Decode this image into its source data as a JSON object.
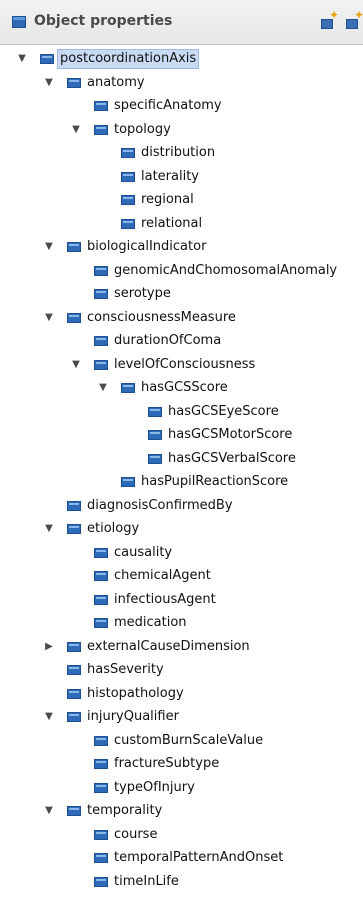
{
  "panel": {
    "title": "Object properties",
    "icon": "object-property-icon",
    "buttons": [
      {
        "name": "add-sub-property-button",
        "icon": "add-sub-property-icon"
      },
      {
        "name": "add-sibling-property-button",
        "icon": "add-sibling-property-icon"
      }
    ]
  },
  "colors": {
    "icon_blue": "#2d6bb8",
    "selection": "#c8dbf3"
  },
  "tree": [
    {
      "label": "postcoordinationAxis",
      "depth": 0,
      "toggle": "expanded",
      "selected": true
    },
    {
      "label": "anatomy",
      "depth": 1,
      "toggle": "expanded"
    },
    {
      "label": "specificAnatomy",
      "depth": 2,
      "toggle": "none"
    },
    {
      "label": "topology",
      "depth": 2,
      "toggle": "expanded"
    },
    {
      "label": "distribution",
      "depth": 3,
      "toggle": "none"
    },
    {
      "label": "laterality",
      "depth": 3,
      "toggle": "none"
    },
    {
      "label": "regional",
      "depth": 3,
      "toggle": "none"
    },
    {
      "label": "relational",
      "depth": 3,
      "toggle": "none"
    },
    {
      "label": "biologicalIndicator",
      "depth": 1,
      "toggle": "expanded"
    },
    {
      "label": "genomicAndChomosomalAnomaly",
      "depth": 2,
      "toggle": "none"
    },
    {
      "label": "serotype",
      "depth": 2,
      "toggle": "none"
    },
    {
      "label": "consciousnessMeasure",
      "depth": 1,
      "toggle": "expanded"
    },
    {
      "label": "durationOfComa",
      "depth": 2,
      "toggle": "none"
    },
    {
      "label": "levelOfConsciousness",
      "depth": 2,
      "toggle": "expanded"
    },
    {
      "label": "hasGCSScore",
      "depth": 3,
      "toggle": "expanded"
    },
    {
      "label": "hasGCSEyeScore",
      "depth": 4,
      "toggle": "none"
    },
    {
      "label": "hasGCSMotorScore",
      "depth": 4,
      "toggle": "none"
    },
    {
      "label": "hasGCSVerbalScore",
      "depth": 4,
      "toggle": "none"
    },
    {
      "label": "hasPupilReactionScore",
      "depth": 3,
      "toggle": "none"
    },
    {
      "label": "diagnosisConfirmedBy",
      "depth": 1,
      "toggle": "none"
    },
    {
      "label": "etiology",
      "depth": 1,
      "toggle": "expanded"
    },
    {
      "label": "causality",
      "depth": 2,
      "toggle": "none"
    },
    {
      "label": "chemicalAgent",
      "depth": 2,
      "toggle": "none"
    },
    {
      "label": "infectiousAgent",
      "depth": 2,
      "toggle": "none"
    },
    {
      "label": "medication",
      "depth": 2,
      "toggle": "none"
    },
    {
      "label": "externalCauseDimension",
      "depth": 1,
      "toggle": "collapsed"
    },
    {
      "label": "hasSeverity",
      "depth": 1,
      "toggle": "none"
    },
    {
      "label": "histopathology",
      "depth": 1,
      "toggle": "none"
    },
    {
      "label": "injuryQualifier",
      "depth": 1,
      "toggle": "expanded"
    },
    {
      "label": "customBurnScaleValue",
      "depth": 2,
      "toggle": "none"
    },
    {
      "label": "fractureSubtype",
      "depth": 2,
      "toggle": "none"
    },
    {
      "label": "typeOfInjury",
      "depth": 2,
      "toggle": "none"
    },
    {
      "label": "temporality",
      "depth": 1,
      "toggle": "expanded"
    },
    {
      "label": "course",
      "depth": 2,
      "toggle": "none"
    },
    {
      "label": "temporalPatternAndOnset",
      "depth": 2,
      "toggle": "none"
    },
    {
      "label": "timeInLife",
      "depth": 2,
      "toggle": "none"
    }
  ]
}
